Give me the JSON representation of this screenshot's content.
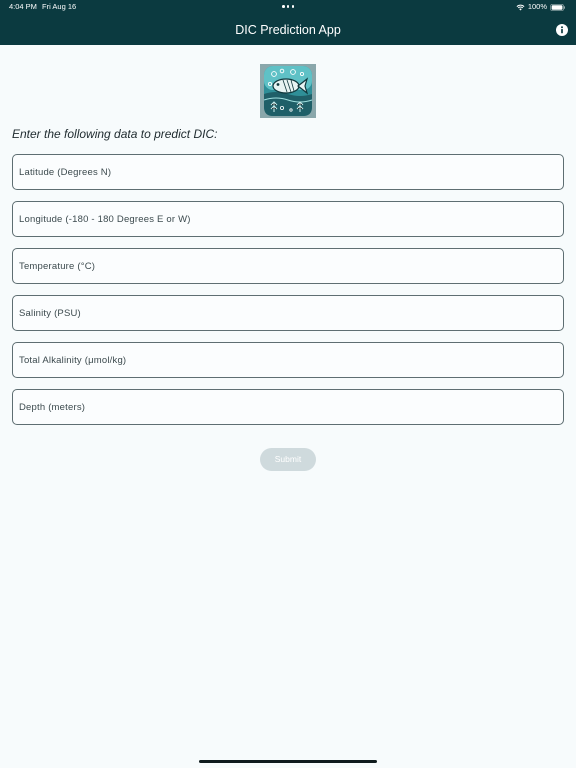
{
  "status_bar": {
    "time": "4:04 PM",
    "date": "Fri Aug 16",
    "battery": "100%"
  },
  "nav": {
    "title": "DIC Prediction App",
    "info_icon": "info-circle-icon"
  },
  "logo": {
    "icon": "fish-app-logo-icon"
  },
  "form": {
    "prompt": "Enter the following data to predict DIC:",
    "fields": [
      {
        "placeholder": "Latitude (Degrees N)"
      },
      {
        "placeholder": "Longitude (-180 - 180 Degrees E or W)"
      },
      {
        "placeholder": "Temperature (°C)"
      },
      {
        "placeholder": "Salinity (PSU)"
      },
      {
        "placeholder": "Total Alkalinity (μmol/kg)"
      },
      {
        "placeholder": "Depth (meters)"
      }
    ],
    "submit_label": "Submit"
  },
  "colors": {
    "header_bg": "#0b3a40",
    "page_bg": "#f7fbfc",
    "field_border": "#5e6e72",
    "submit_disabled_bg": "#cfdadd"
  }
}
